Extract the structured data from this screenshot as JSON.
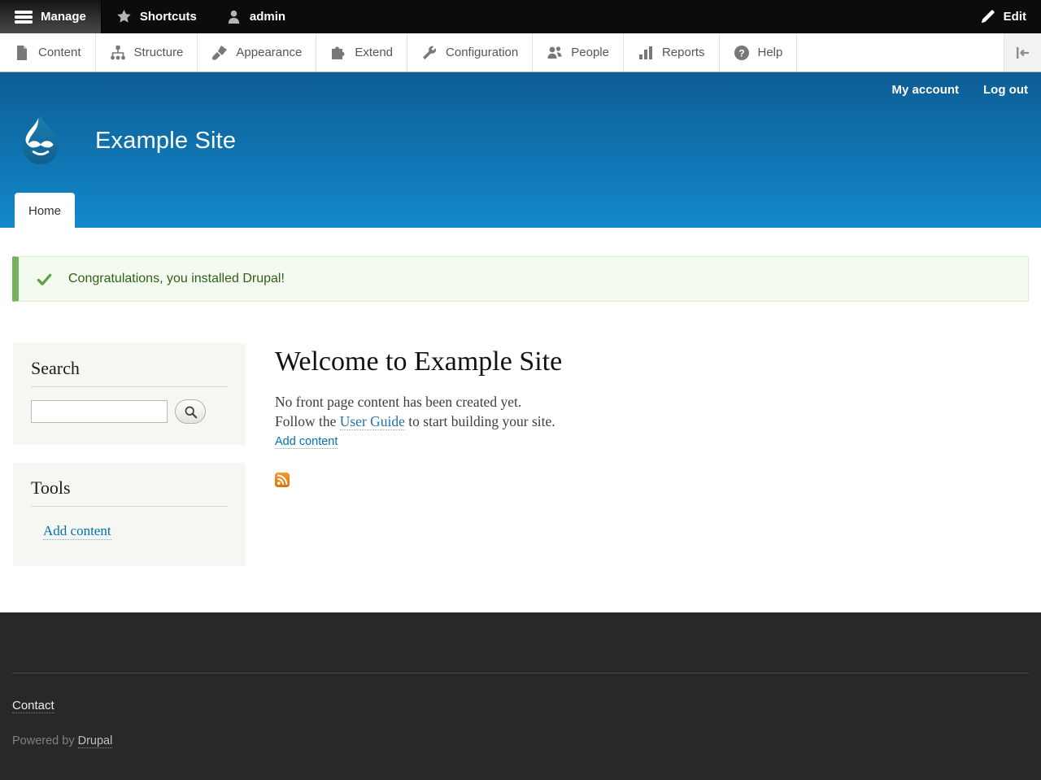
{
  "admin_bar": {
    "manage": "Manage",
    "shortcuts": "Shortcuts",
    "user": "admin",
    "edit": "Edit"
  },
  "toolbar": {
    "items": [
      {
        "label": "Content",
        "icon": "file-icon"
      },
      {
        "label": "Structure",
        "icon": "sitemap-icon"
      },
      {
        "label": "Appearance",
        "icon": "paintbrush-icon"
      },
      {
        "label": "Extend",
        "icon": "puzzle-icon"
      },
      {
        "label": "Configuration",
        "icon": "wrench-icon"
      },
      {
        "label": "People",
        "icon": "people-icon"
      },
      {
        "label": "Reports",
        "icon": "bar-chart-icon"
      },
      {
        "label": "Help",
        "icon": "question-icon"
      }
    ]
  },
  "header": {
    "site_name": "Example Site",
    "secondary": [
      "My account",
      "Log out"
    ],
    "tab": "Home"
  },
  "message": {
    "text": "Congratulations, you installed Drupal!"
  },
  "sidebar": {
    "search_title": "Search",
    "search_value": "",
    "tools_title": "Tools",
    "tools_link": "Add content"
  },
  "content": {
    "title": "Welcome to Example Site",
    "line1": "No front page content has been created yet.",
    "line2_prefix": "Follow the ",
    "line2_link": "User Guide",
    "line2_suffix": " to start building your site.",
    "add_content": "Add content"
  },
  "footer": {
    "contact": "Contact",
    "powered_prefix": "Powered by ",
    "powered_link": "Drupal"
  },
  "colors": {
    "link_blue": "#0071b3",
    "header_gradient_top": "#0d5d95",
    "header_gradient_bottom": "#1289cb",
    "success_border": "#77b259",
    "success_bg": "#f3faef",
    "success_text": "#325e1c",
    "footer_bg": "#282828",
    "rss_orange": "#ec8004"
  }
}
